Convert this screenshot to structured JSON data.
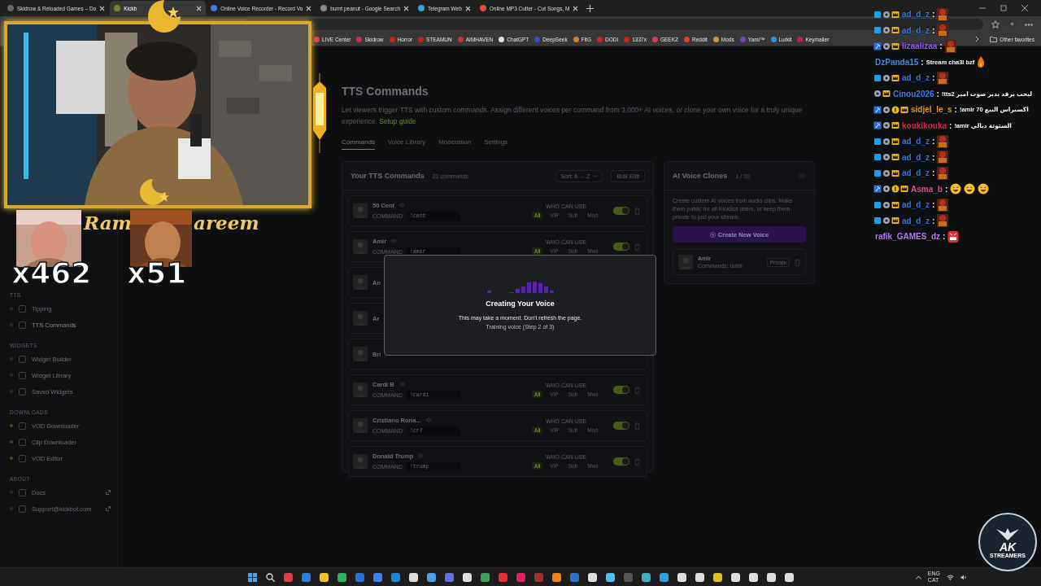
{
  "browser": {
    "tabs": [
      {
        "title": "Skidrow & Reloaded Games – Do",
        "selected": false
      },
      {
        "title": "Kickb",
        "selected": true
      },
      {
        "title": "Online Voice Recorder - Record Vo",
        "selected": false
      },
      {
        "title": "burnt peanut - Google Search",
        "selected": false
      },
      {
        "title": "Telegram Web",
        "selected": false
      },
      {
        "title": "Online MP3 Cutter - Cut Songs, M",
        "selected": false
      }
    ],
    "bookmarks": [
      {
        "label": "LIVE Center"
      },
      {
        "label": "Skidrow"
      },
      {
        "label": "Horror"
      },
      {
        "label": "STEAMUN"
      },
      {
        "label": "AIMHAVEN"
      },
      {
        "label": "ChatGPT"
      },
      {
        "label": "DeepSeek"
      },
      {
        "label": "FitG"
      },
      {
        "label": "DODI"
      },
      {
        "label": "1337x"
      },
      {
        "label": "GEEKZ"
      },
      {
        "label": "Reddit"
      },
      {
        "label": "Mods"
      },
      {
        "label": "Yami™"
      },
      {
        "label": "Lurkit"
      },
      {
        "label": "Keymailer"
      }
    ],
    "other_favorites": "Other favorites"
  },
  "sidebar": {
    "sections": [
      {
        "heading": "TTS",
        "items": [
          {
            "label": "Tipping",
            "selected": false,
            "color": "#2a2c2a"
          },
          {
            "label": "TTS Commands",
            "selected": true,
            "color": "#2a2c2a"
          }
        ]
      },
      {
        "heading": "WIDGETS",
        "items": [
          {
            "label": "Widget Builder",
            "selected": false,
            "color": "#2a2c2a"
          },
          {
            "label": "Widget Library",
            "selected": false,
            "color": "#2a2c2a"
          },
          {
            "label": "Saved Widgets",
            "selected": false,
            "color": "#2a2c2a"
          }
        ]
      },
      {
        "heading": "DOWNLOADS",
        "items": [
          {
            "label": "VOD Downloader",
            "selected": false,
            "color": "#3d4a1c"
          },
          {
            "label": "Clip Downloader",
            "selected": false,
            "color": "#3d4a1c"
          },
          {
            "label": "VOD Editor",
            "selected": false,
            "color": "#3d4a1c"
          }
        ]
      },
      {
        "heading": "ABOUT",
        "items": [
          {
            "label": "Docs",
            "selected": false,
            "color": "#2a2c2a",
            "external": true
          },
          {
            "label": "Support@kickbot.com",
            "selected": false,
            "color": "#2a2c2a",
            "external": true
          }
        ]
      }
    ]
  },
  "page": {
    "title": "TTS Commands",
    "description": "Let viewers trigger TTS with custom commands. Assign different voices per command from 3,000+ AI voices, or clone your own voice for a truly unique experience.",
    "link": "Setup guide",
    "tabs": [
      {
        "label": "Commands",
        "selected": true
      },
      {
        "label": "Voice Library",
        "selected": false
      },
      {
        "label": "Moderation",
        "selected": false
      },
      {
        "label": "Settings",
        "selected": false
      }
    ],
    "commands_card": {
      "title": "Your TTS Commands",
      "count": "21 commands",
      "sort": "Sort: A → Z",
      "bulk_edit": "Bulk Edit",
      "rows": [
        {
          "name": "50 Cent",
          "command_label": "COMMAND",
          "command": "!cent",
          "who_label": "WHO CAN USE",
          "roles": [
            {
              "label": "All",
              "selected": true
            },
            {
              "label": "VIP",
              "selected": false
            },
            {
              "label": "Sub",
              "selected": false
            },
            {
              "label": "Mod",
              "selected": false
            }
          ],
          "enabled": true
        },
        {
          "name": "Amir",
          "command_label": "COMMAND",
          "command": "!amir",
          "who_label": "WHO CAN USE",
          "roles": [
            {
              "label": "All",
              "selected": true
            },
            {
              "label": "VIP",
              "selected": false
            },
            {
              "label": "Sub",
              "selected": false
            },
            {
              "label": "Mod",
              "selected": false
            }
          ],
          "enabled": true
        },
        {
          "name": "An"
        },
        {
          "name": "Ar"
        },
        {
          "name": "Bri"
        },
        {
          "name": "Cardi B",
          "command_label": "COMMAND",
          "command": "!cardi",
          "who_label": "WHO CAN USE",
          "roles": [
            {
              "label": "All",
              "selected": true
            },
            {
              "label": "VIP",
              "selected": false
            },
            {
              "label": "Sub",
              "selected": false
            },
            {
              "label": "Mod",
              "selected": false
            }
          ],
          "enabled": true
        },
        {
          "name": "Cristiano Rona...",
          "command_label": "COMMAND",
          "command": "!cr7",
          "who_label": "WHO CAN USE",
          "roles": [
            {
              "label": "All",
              "selected": true
            },
            {
              "label": "VIP",
              "selected": false
            },
            {
              "label": "Sub",
              "selected": false
            },
            {
              "label": "Mod",
              "selected": false
            }
          ],
          "enabled": true
        },
        {
          "name": "Donald Trump",
          "command_label": "COMMAND",
          "command": "!trump",
          "who_label": "WHO CAN USE",
          "roles": [
            {
              "label": "All",
              "selected": true
            },
            {
              "label": "VIP",
              "selected": false
            },
            {
              "label": "Sub",
              "selected": false
            },
            {
              "label": "Mod",
              "selected": false
            }
          ],
          "enabled": true
        }
      ]
    },
    "clones_card": {
      "title": "AI Voice Clones",
      "count": "1 / 10",
      "description": "Create custom AI voices from audio clips. Make them public for all KickBot users, or keep them private to just your stream.",
      "button": "Create New Voice",
      "clones": [
        {
          "name": "Amir",
          "commands": "Commands: !amir",
          "visibility": "Private"
        }
      ]
    }
  },
  "modal": {
    "title": "Creating Your Voice",
    "message": "This may take a moment. Don't refresh the page.",
    "step": "Training voice (Step 2 of 3)"
  },
  "overlay": {
    "banner_parts": [
      "Ram",
      "areem"
    ],
    "counters": [
      "x462",
      "x51"
    ],
    "chat": [
      {
        "user": "ad_d_z",
        "color": "#2f78e0",
        "separator": ":",
        "badges": [
          {
            "kind": "cube"
          },
          {
            "kind": "gear"
          },
          {
            "kind": "crown"
          }
        ],
        "emotes": [
          {
            "kind": "face"
          }
        ]
      },
      {
        "user": "ad_d_z",
        "color": "#2f78e0",
        "separator": ":",
        "badges": [
          {
            "kind": "cube"
          },
          {
            "kind": "gear"
          },
          {
            "kind": "crown"
          }
        ],
        "emotes": [
          {
            "kind": "face"
          }
        ]
      },
      {
        "user": "lizaalizaa",
        "color": "#9a5cf0",
        "separator": ":",
        "badges": [
          {
            "kind": "hammer"
          },
          {
            "kind": "gear"
          },
          {
            "kind": "crown"
          }
        ],
        "emotes": [
          {
            "kind": "face"
          }
        ]
      },
      {
        "user": "DzPanda15",
        "color": "#3f8fe8",
        "separator": ":",
        "text": "Stream cha3l bzf",
        "emotes": [
          {
            "kind": "fire"
          }
        ]
      },
      {
        "user": "ad_d_z",
        "color": "#2f78e0",
        "separator": ":",
        "badges": [
          {
            "kind": "cube"
          },
          {
            "kind": "gear"
          },
          {
            "kind": "crown"
          }
        ],
        "emotes": [
          {
            "kind": "face"
          }
        ]
      },
      {
        "user": "Cinou2026",
        "color": "#3f80e0",
        "separator": ":",
        "badges": [
          {
            "kind": "gear"
          },
          {
            "kind": "crown"
          }
        ],
        "text": "!tts2 ليحب يرقد يدير صوت امير"
      },
      {
        "user": "sidjel_le_s",
        "color": "#e09a30",
        "separator": ":",
        "badges": [
          {
            "kind": "hammer"
          },
          {
            "kind": "gear"
          },
          {
            "kind": "coin"
          },
          {
            "kind": "crown"
          }
        ],
        "text": "!amir 70 اكسبراس البيع"
      },
      {
        "user": "koukikouka",
        "color": "#d82848",
        "separator": ":",
        "badges": [
          {
            "kind": "hammer"
          },
          {
            "kind": "gear"
          },
          {
            "kind": "crown"
          }
        ],
        "text": "!amir الستوتة ديالي"
      },
      {
        "user": "ad_d_z",
        "color": "#2f78e0",
        "separator": ":",
        "badges": [
          {
            "kind": "cube"
          },
          {
            "kind": "gear"
          },
          {
            "kind": "crown"
          }
        ],
        "emotes": [
          {
            "kind": "face"
          }
        ]
      },
      {
        "user": "ad_d_z",
        "color": "#2f78e0",
        "separator": ":",
        "badges": [
          {
            "kind": "cube"
          },
          {
            "kind": "gear"
          },
          {
            "kind": "crown"
          }
        ],
        "emotes": [
          {
            "kind": "face"
          }
        ]
      },
      {
        "user": "ad_d_z",
        "color": "#2f78e0",
        "separator": ":",
        "badges": [
          {
            "kind": "cube"
          },
          {
            "kind": "gear"
          },
          {
            "kind": "crown"
          }
        ],
        "emotes": [
          {
            "kind": "face"
          }
        ]
      },
      {
        "user": "Asma_b",
        "color": "#e0508a",
        "separator": ":",
        "badges": [
          {
            "kind": "hammer"
          },
          {
            "kind": "gear"
          },
          {
            "kind": "coin"
          },
          {
            "kind": "crown"
          }
        ],
        "emotes": [
          {
            "kind": "laugh"
          },
          {
            "kind": "laugh"
          },
          {
            "kind": "laugh"
          }
        ]
      },
      {
        "user": "ad_d_z",
        "color": "#2f78e0",
        "separator": ":",
        "badges": [
          {
            "kind": "cube"
          },
          {
            "kind": "gear"
          },
          {
            "kind": "crown"
          }
        ],
        "emotes": [
          {
            "kind": "face"
          }
        ]
      },
      {
        "user": "ad_d_z",
        "color": "#2f78e0",
        "separator": ":",
        "badges": [
          {
            "kind": "cube"
          },
          {
            "kind": "gear"
          },
          {
            "kind": "crown"
          }
        ],
        "emotes": [
          {
            "kind": "face"
          }
        ]
      },
      {
        "user": "rafik_GAMES_dz",
        "color": "#b47cf8",
        "separator": ":",
        "emotes": [
          {
            "kind": "angry"
          }
        ]
      }
    ],
    "logo": {
      "big": "AK",
      "small": "STREAMERS"
    }
  },
  "taskbar": {
    "language": [
      "ENG",
      "CAT"
    ]
  }
}
